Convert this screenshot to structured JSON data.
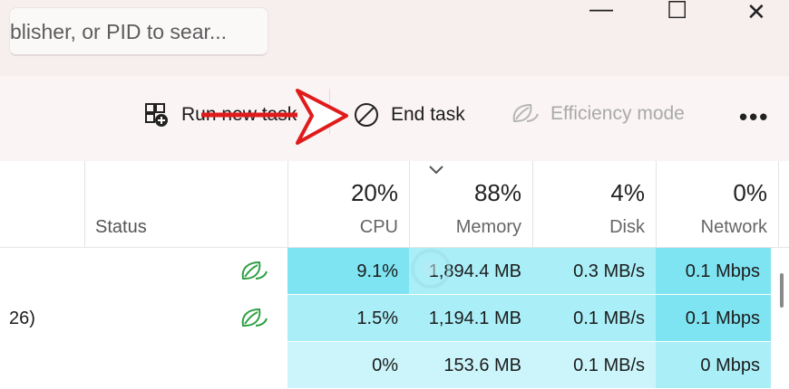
{
  "search": {
    "text": "blisher, or PID to sear..."
  },
  "window_controls": {
    "minimize": "—",
    "maximize": "☐",
    "close": "✕"
  },
  "toolbar": {
    "run_new_task": "Run new task",
    "end_task": "End task",
    "efficiency_mode": "Efficiency mode",
    "more": "•••"
  },
  "columns": {
    "status": "Status",
    "cpu": {
      "pct": "20%",
      "label": "CPU"
    },
    "memory": {
      "pct": "88%",
      "label": "Memory"
    },
    "disk": {
      "pct": "4%",
      "label": "Disk"
    },
    "network": {
      "pct": "0%",
      "label": "Network"
    }
  },
  "rows": [
    {
      "name": "",
      "efficiency": true,
      "cpu": "9.1%",
      "memory": "1,894.4 MB",
      "disk": "0.3 MB/s",
      "network": "0.1 Mbps"
    },
    {
      "name": "26)",
      "efficiency": true,
      "cpu": "1.5%",
      "memory": "1,194.1 MB",
      "disk": "0.1 MB/s",
      "network": "0.1 Mbps"
    },
    {
      "name": "",
      "efficiency": false,
      "cpu": "0%",
      "memory": "153.6 MB",
      "disk": "0.1 MB/s",
      "network": "0 Mbps"
    }
  ],
  "colors": {
    "heat_high": "#7fe4f2",
    "heat_mid": "#aaeef7",
    "heat_low": "#ccf5fb",
    "annotation_arrow": "#e01b1b",
    "leaf_green": "#2ea043"
  }
}
